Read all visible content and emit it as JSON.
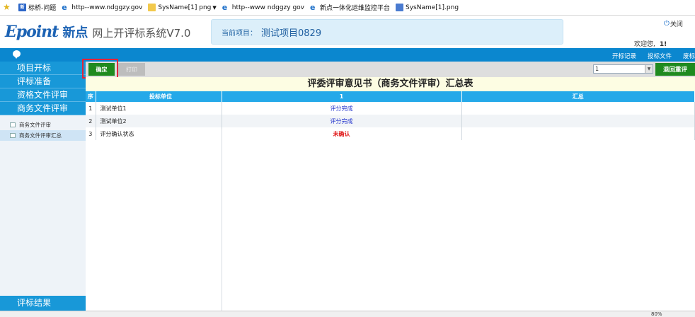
{
  "favorites": [
    {
      "icon": "star-icon",
      "label": ""
    },
    {
      "icon": "news-icon",
      "label": "标桥-问题"
    },
    {
      "icon": "ie-icon",
      "label": "http--www.ndggzy.gov"
    },
    {
      "icon": "folder-icon",
      "label": "SysName[1] png",
      "dropdown": true
    },
    {
      "icon": "ie-icon",
      "label": "http--www ndggzy gov"
    },
    {
      "icon": "ie-icon",
      "label": "新点一体化运维监控平台"
    },
    {
      "icon": "image-icon",
      "label": "SysName[1].png"
    }
  ],
  "header": {
    "logo_brand": "Epoint",
    "logo_cn": "新点",
    "system_name": "网上开评标系统V7.0",
    "project_label": "当前项目：",
    "project_name": "测试项目0829",
    "close_label": "关闭",
    "welcome": "欢迎您,",
    "user": "1!"
  },
  "topnav": [
    "开标记录",
    "投标文件",
    "废标"
  ],
  "sidebar": {
    "items": [
      "项目开标",
      "评标准备",
      "资格文件评审",
      "商务文件评审"
    ],
    "subitems": [
      "商务文件评审",
      "商务文件评审汇总"
    ],
    "active_sub": 1,
    "bottom": "评标结果"
  },
  "toolbar": {
    "confirm_label": "确定",
    "print_label": "打印",
    "select_value": "1",
    "back_label": "退回重评"
  },
  "table": {
    "title": "评委评审意见书（商务文件评审）汇总表",
    "headers": [
      "序",
      "投标单位",
      "1",
      "汇总"
    ],
    "rows": [
      {
        "seq": "1",
        "name": "测试单位1",
        "score": "评分完成",
        "status": "ok"
      },
      {
        "seq": "2",
        "name": "测试单位2",
        "score": "评分完成",
        "status": "ok"
      },
      {
        "seq": "3",
        "name": "评分确认状态",
        "score": "未确认",
        "status": "warn"
      }
    ]
  },
  "statusbar": {
    "zoom": "80%"
  }
}
